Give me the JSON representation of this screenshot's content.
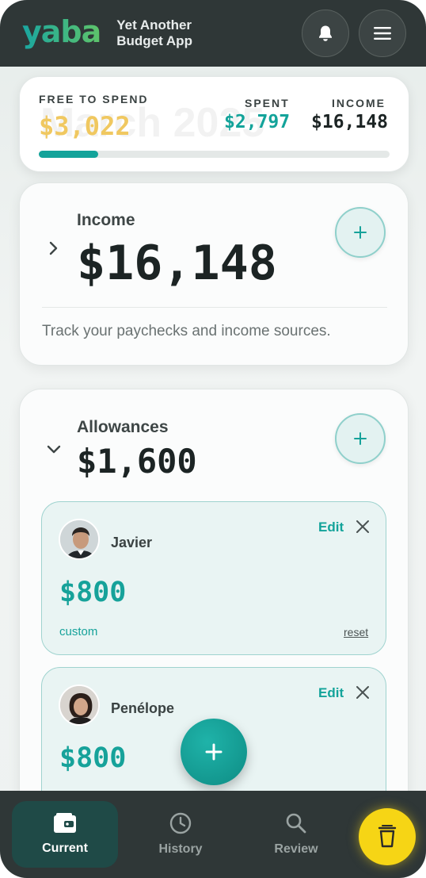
{
  "app": {
    "logo": "yaba",
    "tagline_line1": "Yet Another",
    "tagline_line2": "Budget App"
  },
  "header": {
    "notifications_icon": "bell-icon",
    "menu_icon": "hamburger-menu-icon"
  },
  "summary": {
    "watermark": "March 2025",
    "free_label": "FREE TO SPEND",
    "free_value": "$3,022",
    "spent_label": "SPENT",
    "spent_value": "$2,797",
    "income_label": "INCOME",
    "income_value": "$16,148",
    "progress_fraction": 0.17,
    "colors": {
      "free": "#f0c860",
      "spent": "#13a39a",
      "income": "#1c2424",
      "progress": "#13a39a"
    }
  },
  "income_card": {
    "title": "Income",
    "amount": "$16,148",
    "description": "Track your paychecks and income sources.",
    "expanded": false
  },
  "allowances_card": {
    "title": "Allowances",
    "amount": "$1,600",
    "expanded": true,
    "people": [
      {
        "name": "Javier",
        "amount": "$800",
        "tag": "custom",
        "reset": "reset",
        "edit": "Edit"
      },
      {
        "name": "Penélope",
        "amount": "$800",
        "edit": "Edit"
      }
    ]
  },
  "bottom_nav": {
    "items": [
      {
        "label": "Current",
        "icon": "wallet-icon",
        "active": true
      },
      {
        "label": "History",
        "icon": "clock-icon",
        "active": false
      },
      {
        "label": "Review",
        "icon": "search-icon",
        "active": false
      }
    ],
    "coffee_icon": "coffee-cup-icon"
  },
  "fab_icon": "plus-icon"
}
